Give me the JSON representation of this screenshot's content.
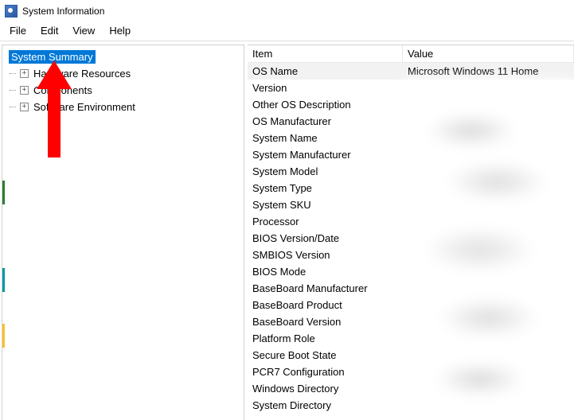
{
  "window": {
    "title": "System Information"
  },
  "menu": {
    "file": "File",
    "edit": "Edit",
    "view": "View",
    "help": "Help"
  },
  "sidebar": {
    "root": "System Summary",
    "nodes": [
      "Hardware Resources",
      "Components",
      "Software Environment"
    ]
  },
  "grid": {
    "col_item": "Item",
    "col_value": "Value",
    "rows": [
      {
        "item": "OS Name",
        "value": "Microsoft Windows 11 Home"
      },
      {
        "item": "Version",
        "value": ""
      },
      {
        "item": "Other OS Description",
        "value": ""
      },
      {
        "item": "OS Manufacturer",
        "value": ""
      },
      {
        "item": "System Name",
        "value": ""
      },
      {
        "item": "System Manufacturer",
        "value": ""
      },
      {
        "item": "System Model",
        "value": ""
      },
      {
        "item": "System Type",
        "value": ""
      },
      {
        "item": "System SKU",
        "value": ""
      },
      {
        "item": "Processor",
        "value": ""
      },
      {
        "item": "BIOS Version/Date",
        "value": ""
      },
      {
        "item": "SMBIOS Version",
        "value": ""
      },
      {
        "item": "BIOS Mode",
        "value": ""
      },
      {
        "item": "BaseBoard Manufacturer",
        "value": ""
      },
      {
        "item": "BaseBoard Product",
        "value": ""
      },
      {
        "item": "BaseBoard Version",
        "value": ""
      },
      {
        "item": "Platform Role",
        "value": ""
      },
      {
        "item": "Secure Boot State",
        "value": ""
      },
      {
        "item": "PCR7 Configuration",
        "value": ""
      },
      {
        "item": "Windows Directory",
        "value": ""
      },
      {
        "item": "System Directory",
        "value": ""
      }
    ]
  },
  "annotation": {
    "arrow_color": "#ff0000"
  }
}
